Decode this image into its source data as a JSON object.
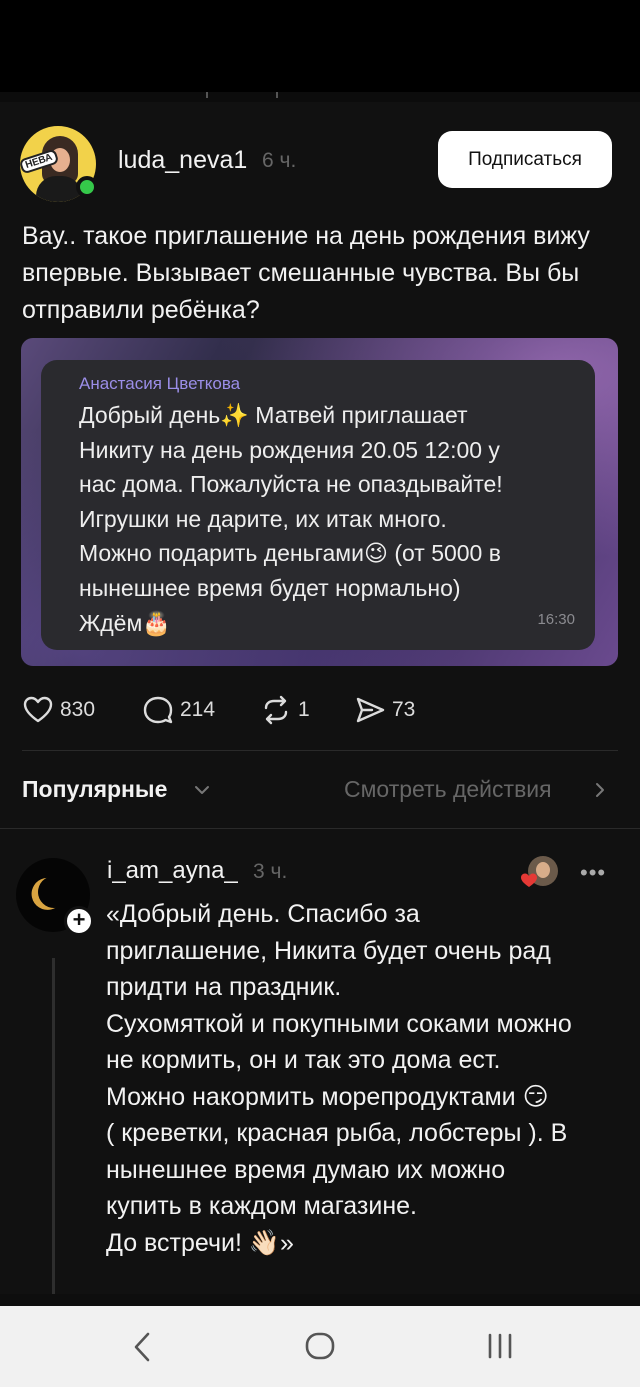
{
  "post": {
    "username": "luda_neva1",
    "time": "6 ч.",
    "subscribe_label": "Подписаться",
    "avatar_badge": "НЕВА",
    "text": "Вау.. такое приглашение на день рождения вижу впервые. Вызывает смешанные чувства. Вы бы отправили ребёнка?",
    "message": {
      "sender": "Анастасия Цветкова",
      "text": "Добрый день✨ Матвей приглашает\nНикиту на день  рождения 20.05 12:00 у\nнас дома. Пожалуйста не опаздывайте!\nИгрушки не дарите, их итак много.\nМожно подарить деньгами😉 (от 5000 в\nнынешнее время будет нормально)\nЖдём🎂",
      "time": "16:30"
    },
    "likes": "830",
    "comments": "214",
    "reposts": "1",
    "shares": "73"
  },
  "sort": {
    "label": "Популярные",
    "activity_label": "Смотреть действия"
  },
  "comment": {
    "username": "i_am_ayna_",
    "time": "3 ч.",
    "more": "•••",
    "text": "«Добрый день. Спасибо за\nприглашение, Никита будет очень рад\nпридти на праздник.\nСухомяткой и покупными соками можно\nне кормить, он и так это дома ест.\nМожно накормить морепродуктами 😏\n( креветки, красная рыба, лобстеры ). В\nнынешнее время думаю их можно\nкупить в каждом магазине.\nДо встречи! 👋🏻»"
  },
  "colors": {
    "background": "#111111",
    "accent_sender": "#9b8ee8",
    "online": "#35c84a",
    "liked_heart": "#e53935"
  },
  "icons": [
    "heart-icon",
    "comment-icon",
    "repost-icon",
    "share-icon",
    "chevron-down-icon",
    "chevron-right-icon",
    "more-icon",
    "back-nav-icon",
    "home-nav-icon",
    "recents-nav-icon"
  ]
}
